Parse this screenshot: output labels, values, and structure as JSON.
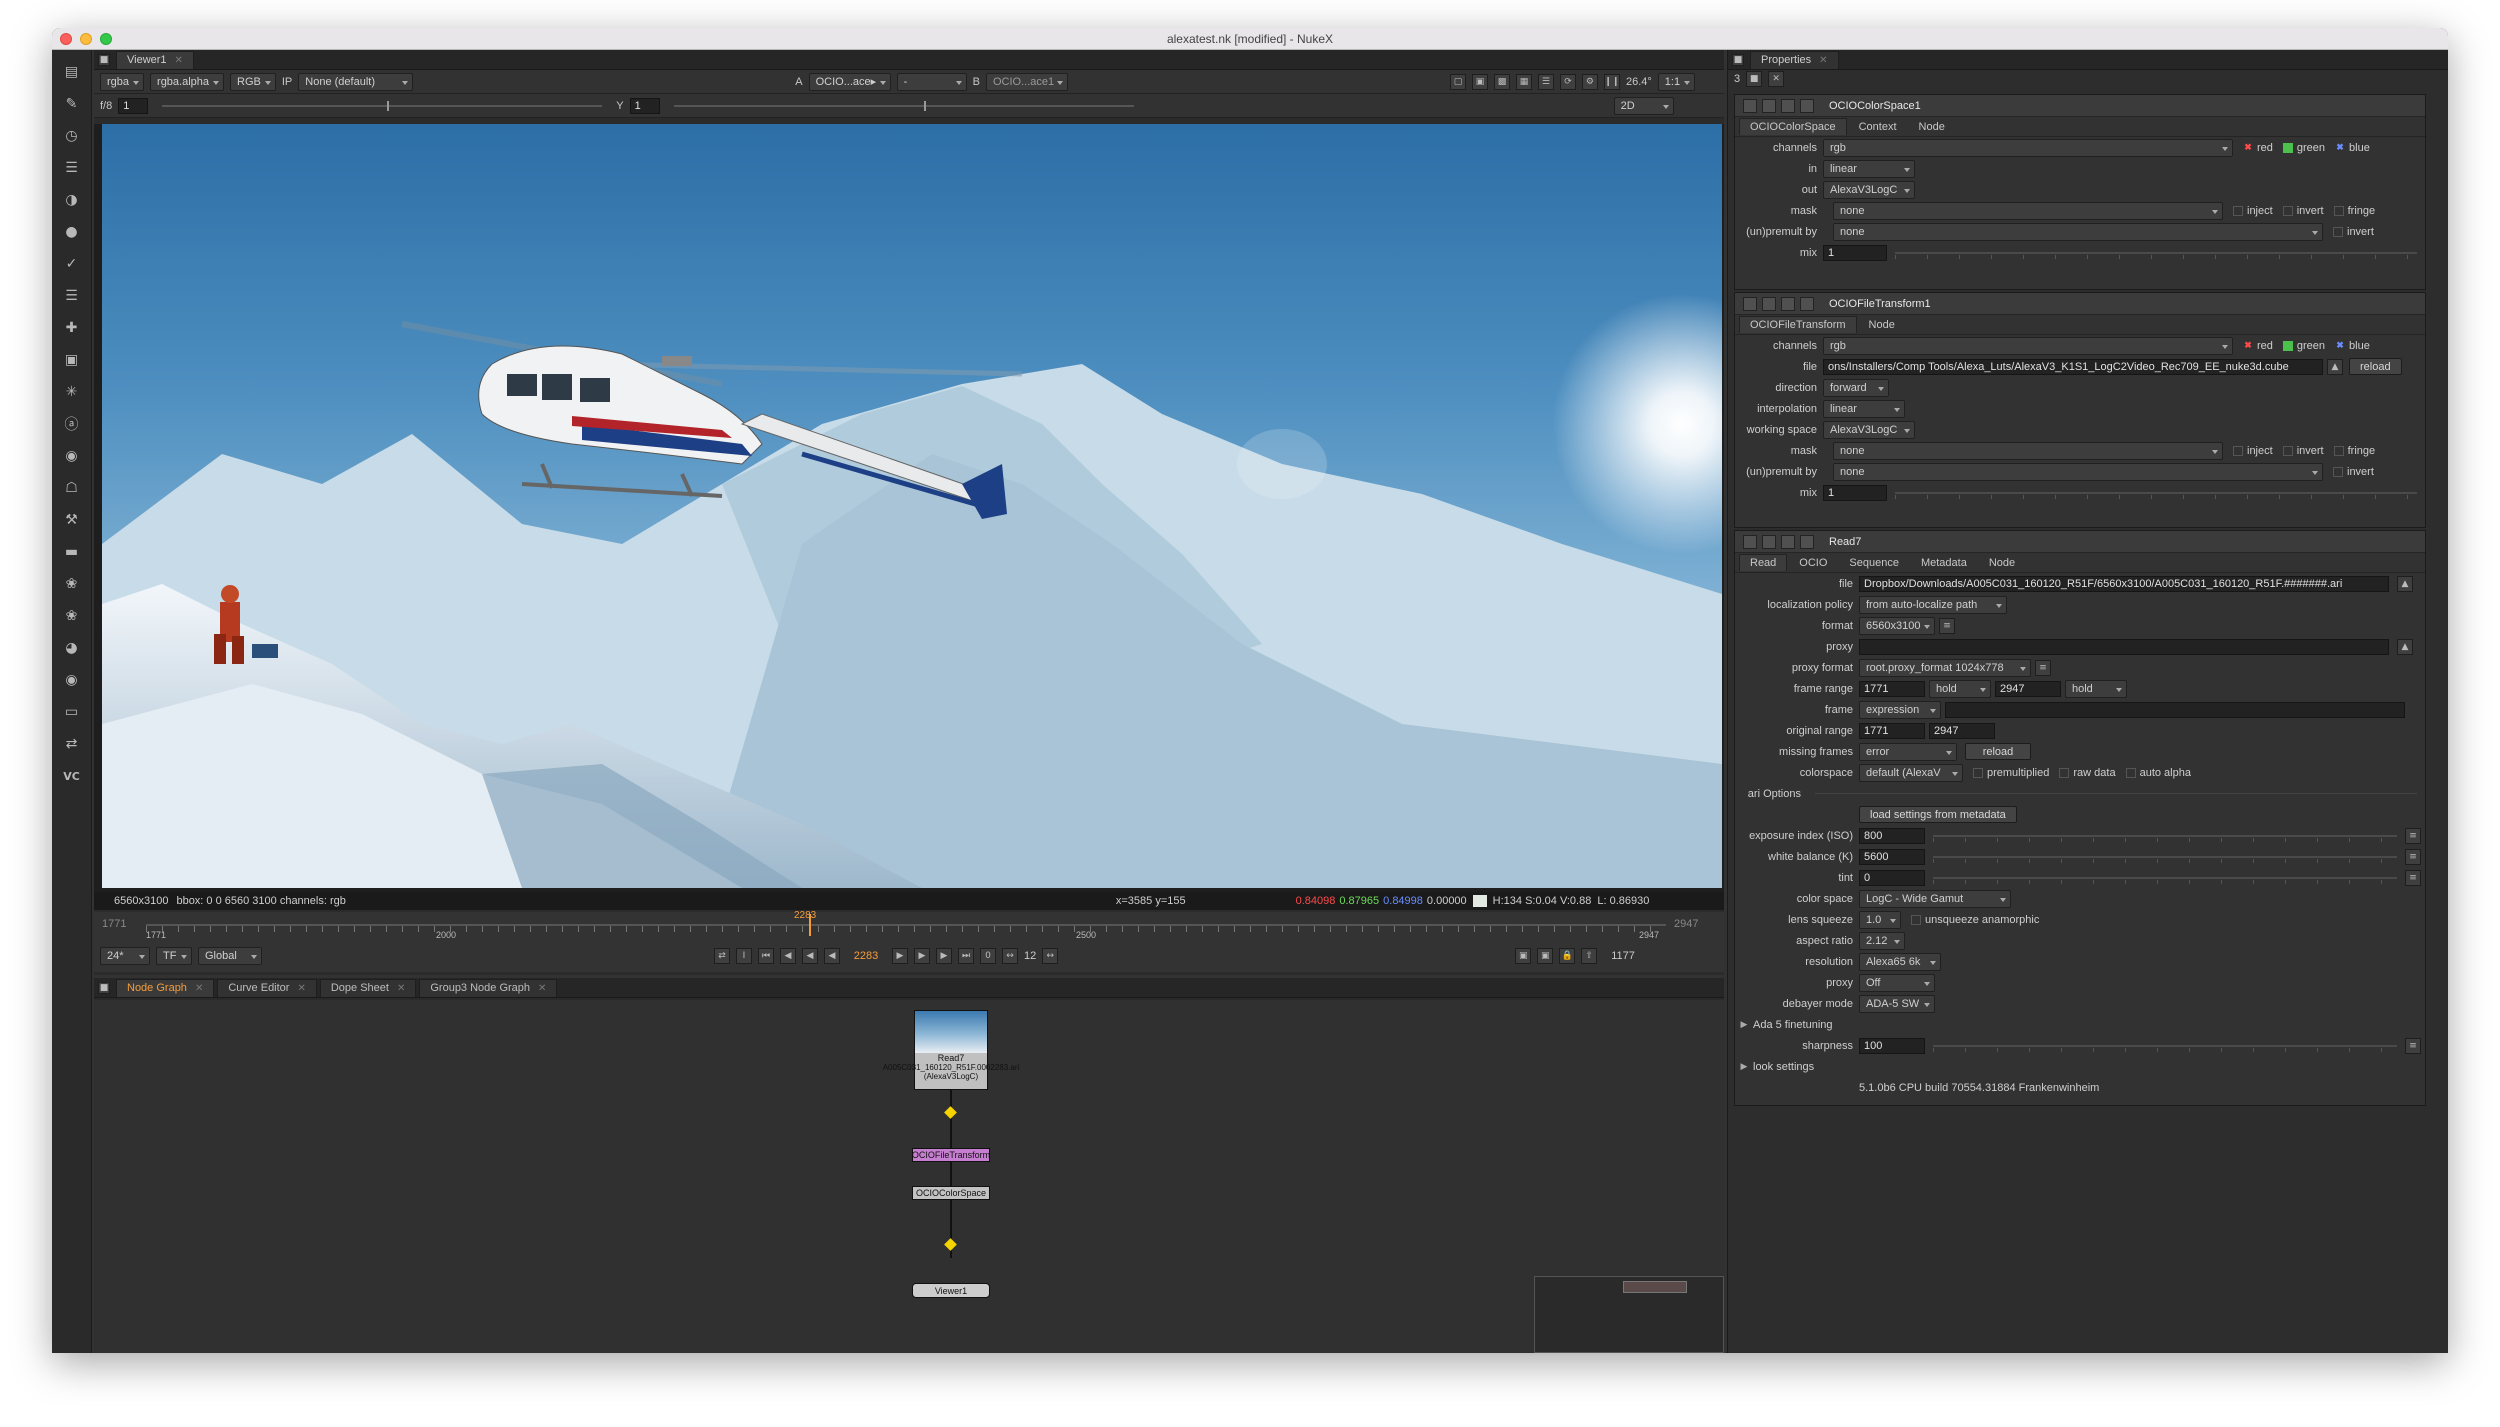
{
  "window": {
    "title": "alexatest.nk [modified] - NukeX"
  },
  "viewer": {
    "tab_label": "Viewer1",
    "toolbar": {
      "channels": "rgba",
      "alpha": "rgba.alpha",
      "colorspace": "RGB",
      "ip": "IP",
      "lut": "None (default)",
      "input_a_label": "A",
      "input_a": "OCIO...ace▸",
      "composite": "-",
      "input_b_label": "B",
      "input_b": "OCIO...ace1",
      "zoom": "26.4°",
      "ratio": "1:1"
    },
    "row2": {
      "fstop": "f/8",
      "gain": "1",
      "gamma_label": "Y",
      "gamma": "1",
      "mode": "2D"
    },
    "info": {
      "format": "6560x3100",
      "bbox": "bbox: 0 0 6560 3100 channels: rgb",
      "coords": "x=3585 y=155",
      "r": "0.84098",
      "g": "0.87965",
      "b": "0.84998",
      "a": "0.00000",
      "hsv": "H:134 S:0.04 V:0.88",
      "luma": "L: 0.86930"
    },
    "timeline": {
      "start": "1771",
      "end": "2947",
      "mid": "2000",
      "mid2": "2500",
      "current": "2283",
      "first_frame": "1771",
      "last_frame": "2947",
      "fps": "24*",
      "tf": "TF",
      "range": "Global",
      "frame": "2283",
      "step": "12",
      "count": "1177",
      "zero": "0"
    }
  },
  "nodegraph": {
    "tabs": [
      "Node Graph",
      "Curve Editor",
      "Dope Sheet",
      "Group3 Node Graph"
    ],
    "nodes": {
      "read_title": "Read7",
      "read_file": "A005C031_160120_R51F.0002283.ari",
      "read_cs": "(AlexaV3LogC)",
      "filetransform": "OCIOFileTransform",
      "colorspace": "OCIOColorSpace",
      "viewer": "Viewer1"
    }
  },
  "properties": {
    "tab_label": "Properties",
    "max_panels": "3",
    "colorspace_node": {
      "name": "OCIOColorSpace1",
      "tabs": [
        "OCIOColorSpace",
        "Context",
        "Node"
      ],
      "channels_label": "channels",
      "channels": "rgb",
      "red": "red",
      "green": "green",
      "blue": "blue",
      "in_label": "in",
      "in": "linear",
      "out_label": "out",
      "out": "AlexaV3LogC",
      "mask_label": "mask",
      "mask": "none",
      "inject": "inject",
      "invert": "invert",
      "fringe": "fringe",
      "premult_label": "(un)premult by",
      "premult": "none",
      "invert2": "invert",
      "mix_label": "mix",
      "mix": "1"
    },
    "filetransform_node": {
      "name": "OCIOFileTransform1",
      "tabs": [
        "OCIOFileTransform",
        "Node"
      ],
      "channels_label": "channels",
      "channels": "rgb",
      "red": "red",
      "green": "green",
      "blue": "blue",
      "file_label": "file",
      "file": "ons/Installers/Comp Tools/Alexa_Luts/AlexaV3_K1S1_LogC2Video_Rec709_EE_nuke3d.cube",
      "reload": "reload",
      "direction_label": "direction",
      "direction": "forward",
      "interp_label": "interpolation",
      "interp": "linear",
      "ws_label": "working space",
      "ws": "AlexaV3LogC",
      "mask_label": "mask",
      "mask": "none",
      "inject": "inject",
      "invert": "invert",
      "fringe": "fringe",
      "premult_label": "(un)premult by",
      "premult": "none",
      "invert2": "invert",
      "mix_label": "mix",
      "mix": "1"
    },
    "read_node": {
      "name": "Read7",
      "tabs": [
        "Read",
        "OCIO",
        "Sequence",
        "Metadata",
        "Node"
      ],
      "file_label": "file",
      "file": "Dropbox/Downloads/A005C031_160120_R51F/6560x3100/A005C031_160120_R51F.#######.ari",
      "loc_label": "localization policy",
      "loc": "from auto-localize path",
      "format_label": "format",
      "format": "6560x3100",
      "proxy_label": "proxy",
      "proxy": "",
      "pformat_label": "proxy format",
      "pformat": "root.proxy_format 1024x778",
      "frange_label": "frame range",
      "frange_start": "1771",
      "hold1": "hold",
      "frange_end": "2947",
      "hold2": "hold",
      "frame_label": "frame",
      "frame": "expression",
      "orange_label": "original range",
      "orange_start": "1771",
      "orange_end": "2947",
      "missing_label": "missing frames",
      "missing": "error",
      "reload": "reload",
      "cs_label": "colorspace",
      "cs": "default (AlexaV",
      "premultiplied": "premultiplied",
      "raw": "raw data",
      "autoalpha": "auto alpha",
      "ari_label": "ari Options",
      "load_btn": "load settings from metadata",
      "iso_label": "exposure index (ISO)",
      "iso": "800",
      "wb_label": "white balance (K)",
      "wb": "5600",
      "tint_label": "tint",
      "tint": "0",
      "ccs_label": "color space",
      "ccs": "LogC - Wide Gamut",
      "lens_label": "lens squeeze",
      "lens": "1.0",
      "unsqueeze": "unsqueeze anamorphic",
      "aspect_label": "aspect ratio",
      "aspect": "2.12",
      "res_label": "resolution",
      "res": "Alexa65 6k",
      "proxy2_label": "proxy",
      "proxy2": "Off",
      "debayer_label": "debayer mode",
      "debayer": "ADA-5 SW",
      "ada_label": "Ada 5 finetuning",
      "sharp_label": "sharpness",
      "sharp": "100",
      "look_label": "look settings",
      "build": "5.1.0b6 CPU build 70554.31884 Frankenwinheim"
    }
  }
}
